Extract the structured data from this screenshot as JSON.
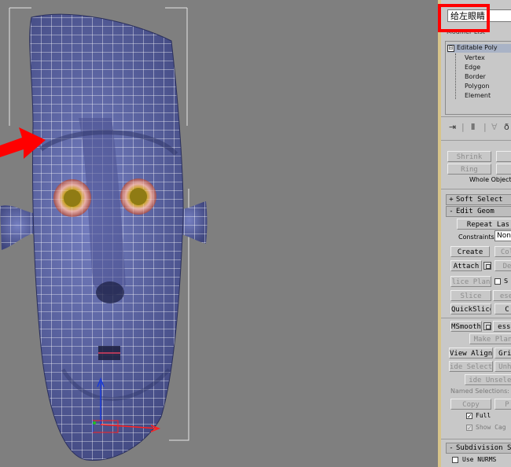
{
  "panel": {
    "object_name": "给左眼睛",
    "modifier_list_label": "Modifier List",
    "stack": {
      "root": "Editable Poly",
      "root_toggle": "⊟",
      "subobjects": [
        "Vertex",
        "Edge",
        "Border",
        "Polygon",
        "Element"
      ]
    },
    "selection": {
      "shrink": "Shrink",
      "ring": "Ring",
      "whole_object": "Whole Object"
    },
    "soft_selection": {
      "sign": "+",
      "title": "Soft Select"
    },
    "edit_geometry": {
      "sign": "-",
      "title": "Edit Geom",
      "repeat_last": "Repeat Las",
      "constraints_label": "Constraints:",
      "constraints_value": "None",
      "create": "Create",
      "collapse": "Col",
      "attach": "Attach",
      "detach": "De",
      "slice_plane": "lice Plan",
      "slice": "Slice",
      "reset_plane": "ese",
      "quickslice": "QuickSlice",
      "cut": "C",
      "msmooth": "MSmooth",
      "tessellate": "esse",
      "make_planar": "Make Plan",
      "view_align": "View Align",
      "grid_align": "Grid",
      "hide_selected": "ide Select",
      "unhide_all": "Unhi",
      "hide_unselected": "ide Unselec",
      "named_selections": "Named Selections:",
      "copy": "Copy",
      "paste": "P",
      "full": "Full",
      "show_cage": "Show Cag"
    },
    "subdivision": {
      "sign": "-",
      "title": "Subdivision Su",
      "use_nurms": "Use NURMS"
    }
  },
  "colors": {
    "mesh_fill": "#5f68a8",
    "wire": "#ffffff",
    "viewport_bg": "#7f7f7f",
    "highlight_red": "#ff0000",
    "eye_iris": "#b88a1a",
    "eye_ring": "#e8a0a0"
  }
}
